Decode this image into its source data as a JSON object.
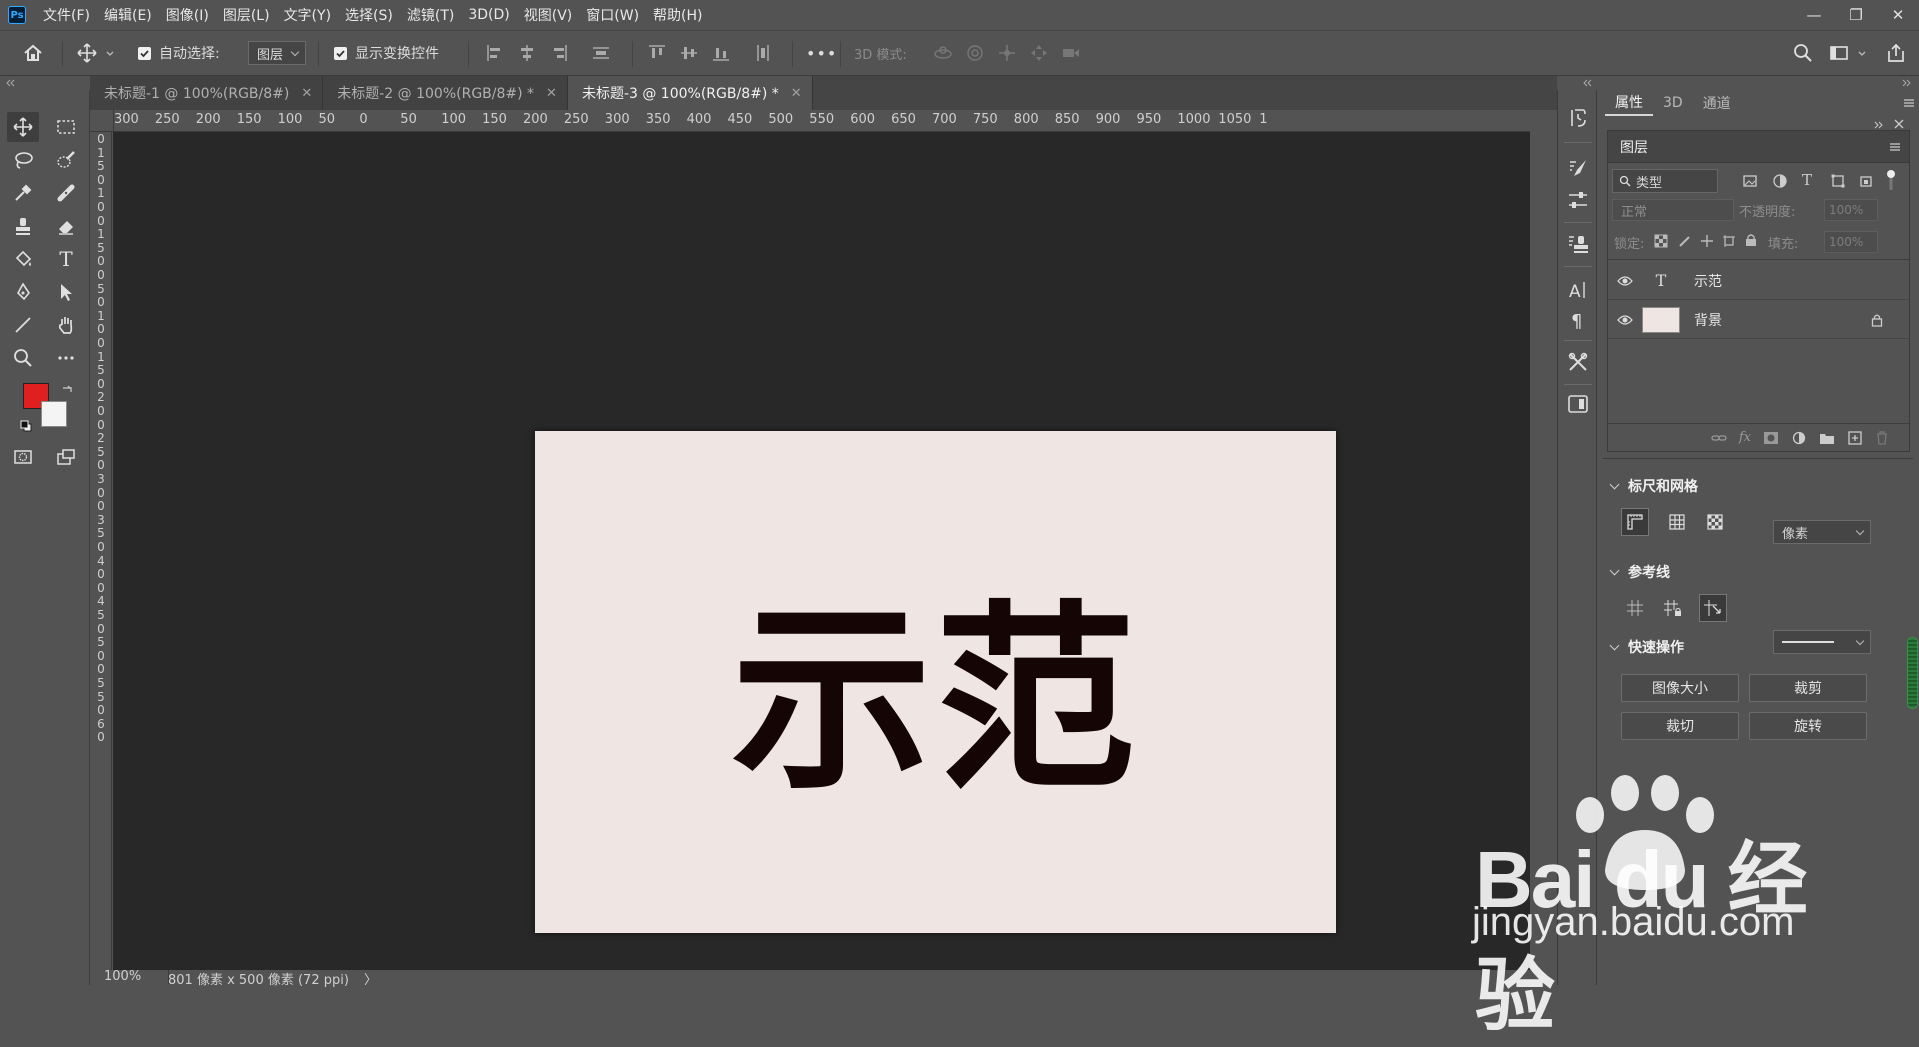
{
  "app": {
    "logo": "Ps",
    "menu": [
      "文件(F)",
      "编辑(E)",
      "图像(I)",
      "图层(L)",
      "文字(Y)",
      "选择(S)",
      "滤镜(T)",
      "3D(D)",
      "视图(V)",
      "窗口(W)",
      "帮助(H)"
    ],
    "window_controls": [
      "—",
      "❐",
      "✕"
    ]
  },
  "options": {
    "auto_select_label": "自动选择:",
    "auto_select_value": "图层",
    "show_transform_label": "显示变换控件",
    "mode_3d_label": "3D 模式:",
    "more": "•••"
  },
  "tabs": [
    {
      "label": "未标题-1 @ 100%(RGB/8#)",
      "close": "✕",
      "active": false
    },
    {
      "label": "未标题-2 @ 100%(RGB/8#) *",
      "close": "✕",
      "active": false
    },
    {
      "label": "未标题-3 @ 100%(RGB/8#) *",
      "close": "✕",
      "active": true
    }
  ],
  "ruler": {
    "h_labels": [
      "300",
      "250",
      "200",
      "150",
      "100",
      "50",
      "0",
      "50",
      "100",
      "150",
      "200",
      "250",
      "300",
      "350",
      "400",
      "450",
      "500",
      "550",
      "600",
      "650",
      "700",
      "750",
      "800",
      "850",
      "900",
      "950",
      "1000",
      "1050",
      "1"
    ],
    "v_labels": [
      "0",
      "1",
      "5",
      "0",
      "1",
      "0",
      "0",
      "1",
      "5",
      "0",
      "0",
      "5",
      "0",
      "1",
      "0",
      "0",
      "1",
      "5",
      "0",
      "2",
      "0",
      "0",
      "2",
      "5",
      "0",
      "3",
      "0",
      "0",
      "3",
      "5",
      "0",
      "4",
      "0",
      "0",
      "4",
      "5",
      "0",
      "5",
      "0",
      "0",
      "5",
      "5",
      "0",
      "6",
      "0"
    ]
  },
  "canvas": {
    "text": "示范",
    "text_color": "#150505",
    "background": "#efe6e4"
  },
  "status": {
    "zoom": "100%",
    "doc_info": "801 像素 x 500 像素 (72 ppi)",
    "arrow": "〉"
  },
  "colors": {
    "foreground": "#e02020",
    "background": "#f4f4f4"
  },
  "panels": {
    "tabs": [
      "属性",
      "3D",
      "通道"
    ],
    "layers": {
      "title": "图层",
      "filter_value": "类型",
      "blend_mode": "正常",
      "opacity_label": "不透明度:",
      "opacity_value": "100%",
      "lock_label": "锁定:",
      "fill_label": "填充:",
      "fill_value": "100%",
      "items": [
        {
          "name": "示范",
          "kind": "text"
        },
        {
          "name": "背景",
          "kind": "image",
          "locked": true
        }
      ]
    },
    "rulers_grid": {
      "title": "标尺和网格",
      "unit": "像素"
    },
    "guides": {
      "title": "参考线"
    },
    "quick_actions": {
      "title": "快速操作",
      "buttons": [
        "图像大小",
        "裁剪",
        "裁切",
        "旋转"
      ]
    }
  },
  "watermark": {
    "brand": "Bai du 经验",
    "site": "jingyan.baidu.com"
  }
}
